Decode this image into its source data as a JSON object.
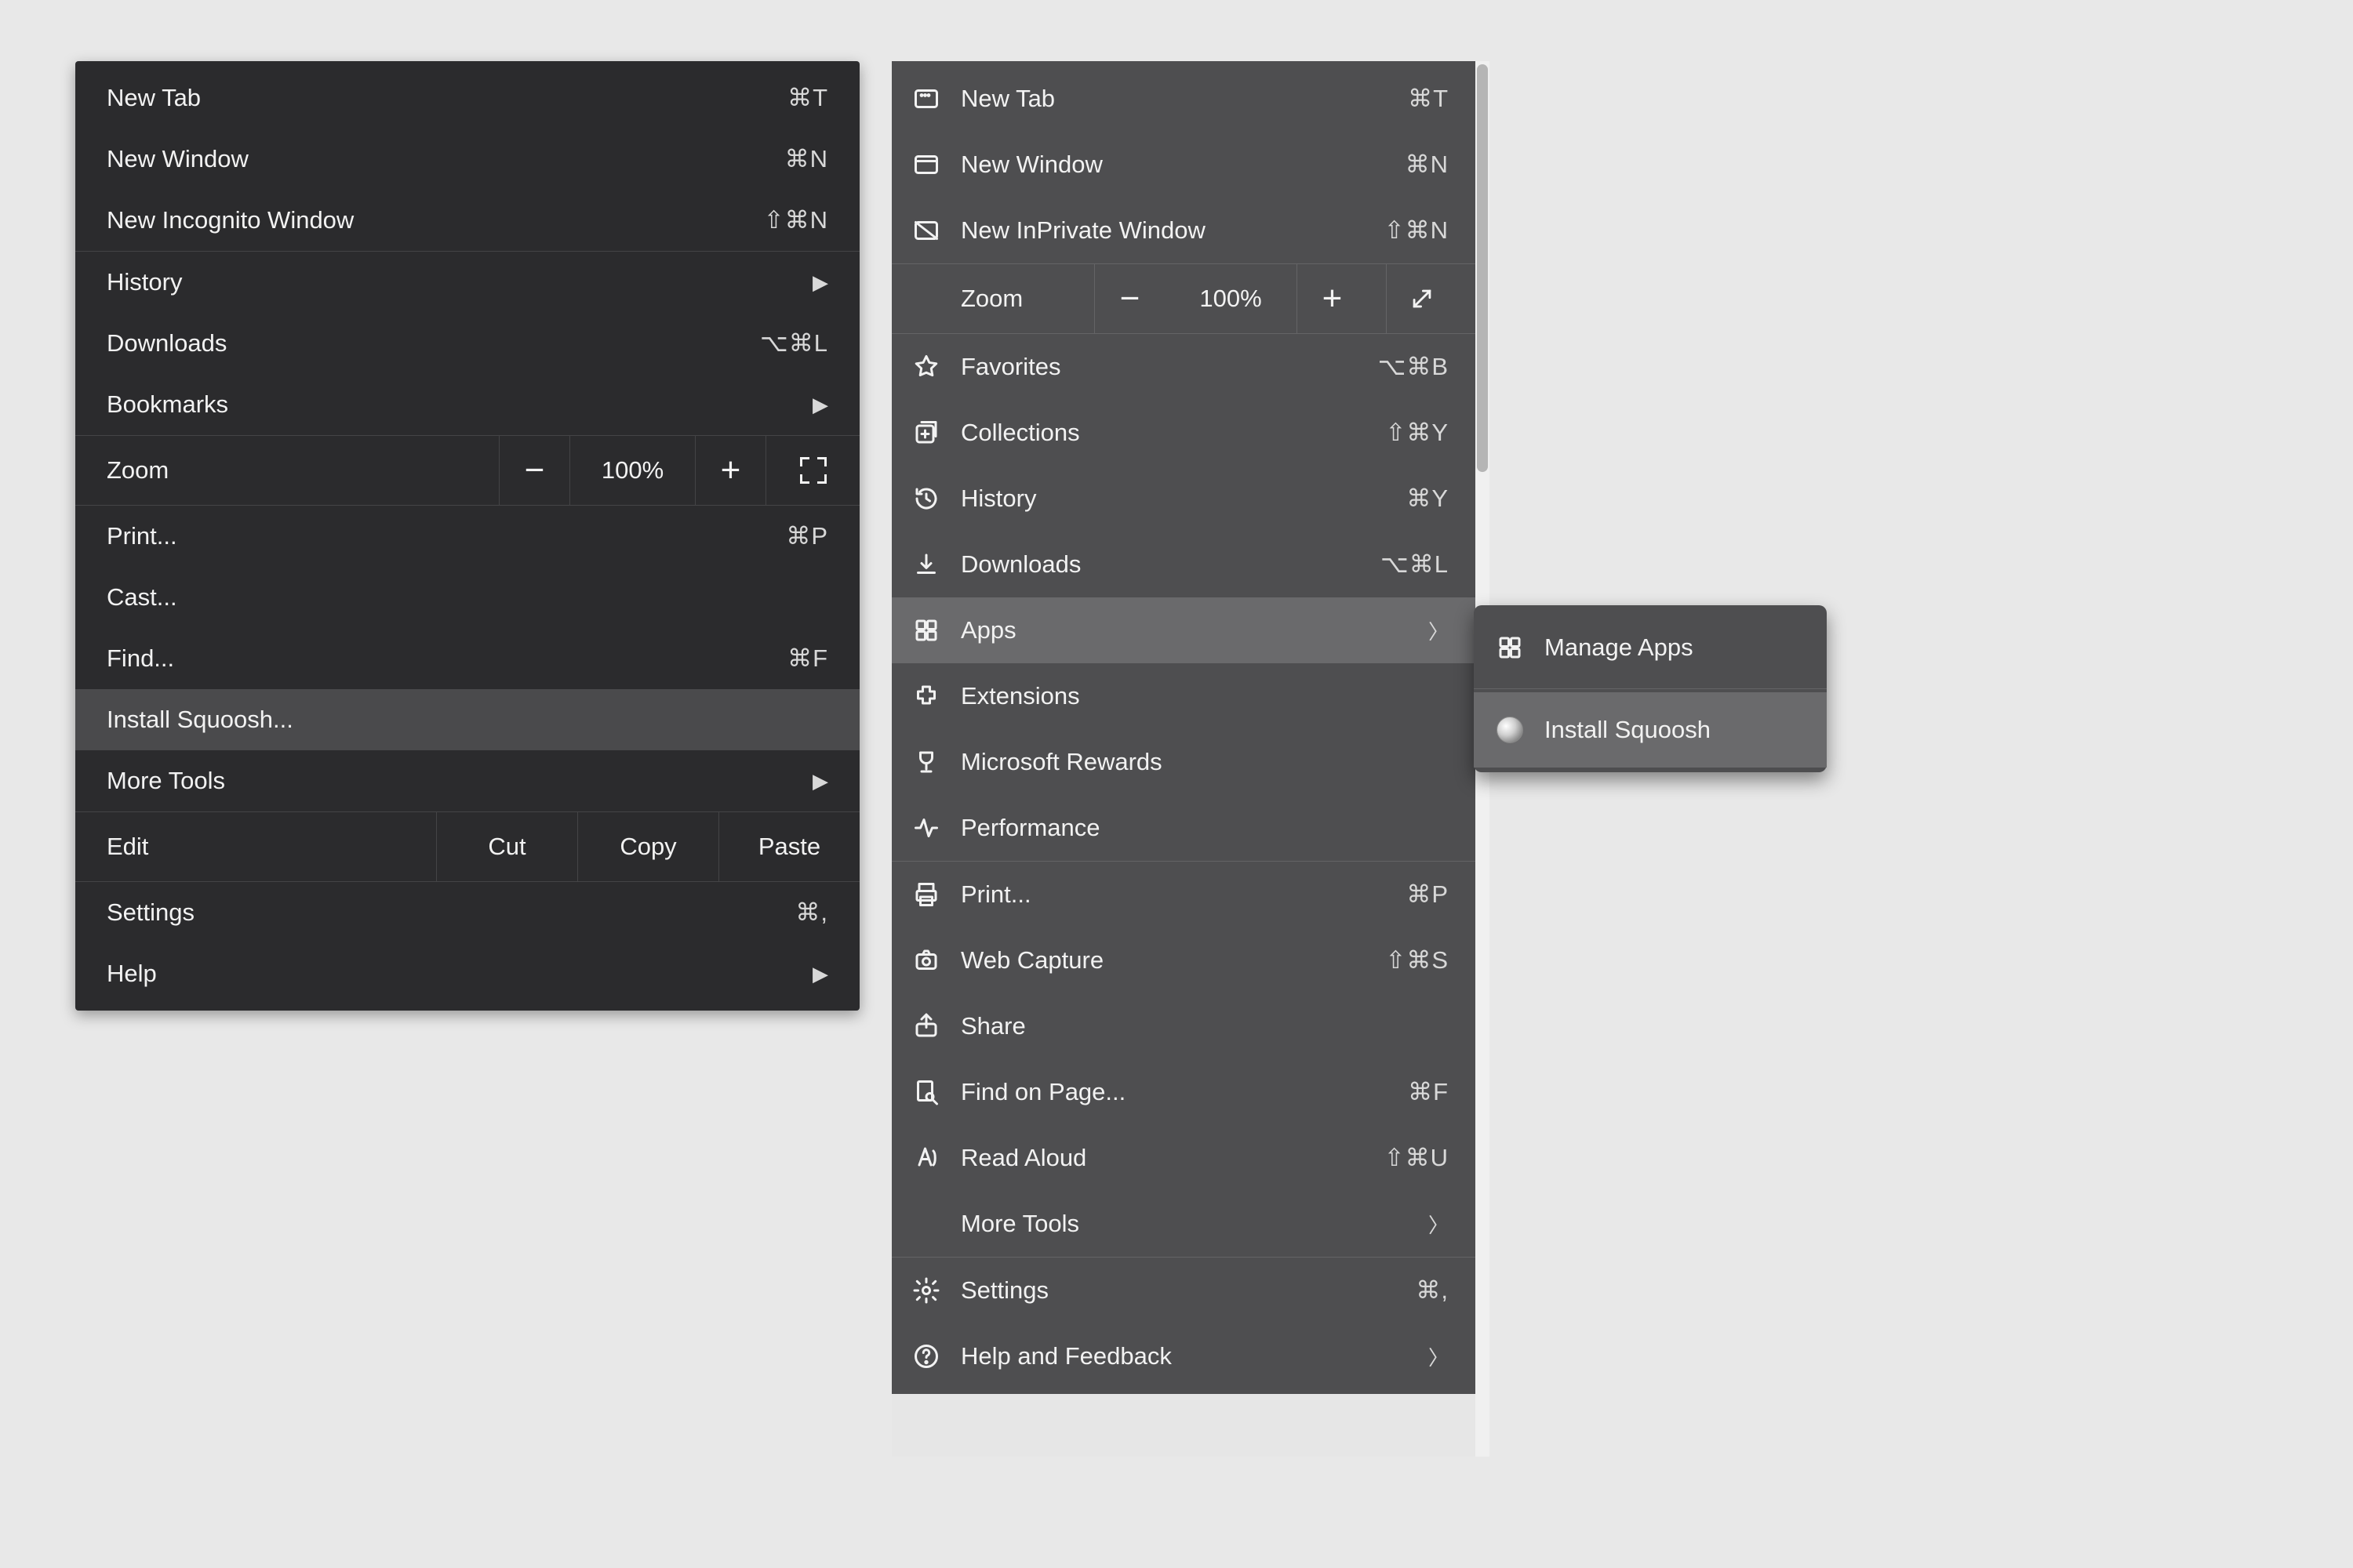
{
  "chrome_menu": {
    "group1": [
      {
        "label": "New Tab",
        "accel": "⌘T"
      },
      {
        "label": "New Window",
        "accel": "⌘N"
      },
      {
        "label": "New Incognito Window",
        "accel": "⇧⌘N"
      }
    ],
    "group2": [
      {
        "label": "History",
        "arrow": true
      },
      {
        "label": "Downloads",
        "accel": "⌥⌘L"
      },
      {
        "label": "Bookmarks",
        "arrow": true
      }
    ],
    "zoom": {
      "label": "Zoom",
      "value": "100%",
      "minus": "−",
      "plus": "+"
    },
    "group3": [
      {
        "label": "Print...",
        "accel": "⌘P"
      },
      {
        "label": "Cast..."
      },
      {
        "label": "Find...",
        "accel": "⌘F"
      },
      {
        "label": "Install Squoosh...",
        "highlight": true
      },
      {
        "label": "More Tools",
        "arrow": true
      }
    ],
    "edit": {
      "label": "Edit",
      "cut": "Cut",
      "copy": "Copy",
      "paste": "Paste"
    },
    "group4": [
      {
        "label": "Settings",
        "accel": "⌘,"
      },
      {
        "label": "Help",
        "arrow": true
      }
    ]
  },
  "edge_menu": {
    "group1": [
      {
        "label": "New Tab",
        "accel": "⌘T",
        "icon": "new-tab"
      },
      {
        "label": "New Window",
        "accel": "⌘N",
        "icon": "window"
      },
      {
        "label": "New InPrivate Window",
        "accel": "⇧⌘N",
        "icon": "inprivate"
      }
    ],
    "zoom": {
      "label": "Zoom",
      "value": "100%",
      "minus": "−",
      "plus": "+"
    },
    "group2": [
      {
        "label": "Favorites",
        "accel": "⌥⌘B",
        "icon": "star"
      },
      {
        "label": "Collections",
        "accel": "⇧⌘Y",
        "icon": "collections"
      },
      {
        "label": "History",
        "accel": "⌘Y",
        "icon": "history"
      },
      {
        "label": "Downloads",
        "accel": "⌥⌘L",
        "icon": "download"
      },
      {
        "label": "Apps",
        "arrow": true,
        "icon": "apps",
        "highlight": true
      },
      {
        "label": "Extensions",
        "icon": "extensions"
      },
      {
        "label": "Microsoft Rewards",
        "icon": "rewards"
      },
      {
        "label": "Performance",
        "icon": "performance"
      }
    ],
    "group3": [
      {
        "label": "Print...",
        "accel": "⌘P",
        "icon": "print"
      },
      {
        "label": "Web Capture",
        "accel": "⇧⌘S",
        "icon": "capture"
      },
      {
        "label": "Share",
        "icon": "share"
      },
      {
        "label": "Find on Page...",
        "accel": "⌘F",
        "icon": "find"
      },
      {
        "label": "Read Aloud",
        "accel": "⇧⌘U",
        "icon": "read"
      },
      {
        "label": "More Tools",
        "arrow": true
      }
    ],
    "group4": [
      {
        "label": "Settings",
        "accel": "⌘,",
        "icon": "settings"
      },
      {
        "label": "Help and Feedback",
        "arrow": true,
        "icon": "help"
      }
    ]
  },
  "apps_submenu": {
    "items": [
      {
        "label": "Manage Apps",
        "icon": "apps"
      },
      {
        "label": "Install Squoosh",
        "icon": "squoosh",
        "highlight": true
      }
    ]
  }
}
